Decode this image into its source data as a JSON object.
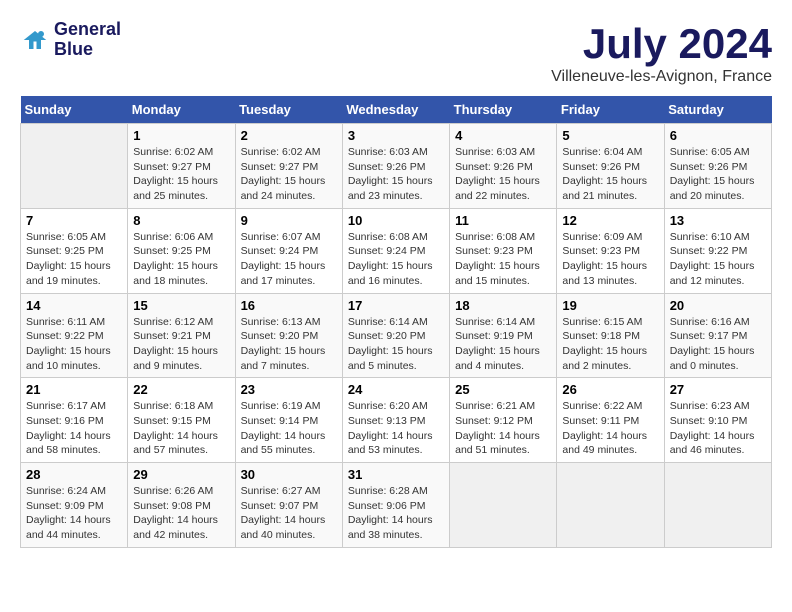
{
  "logo": {
    "line1": "General",
    "line2": "Blue"
  },
  "title": "July 2024",
  "subtitle": "Villeneuve-les-Avignon, France",
  "days_header": [
    "Sunday",
    "Monday",
    "Tuesday",
    "Wednesday",
    "Thursday",
    "Friday",
    "Saturday"
  ],
  "weeks": [
    [
      {
        "num": "",
        "info": ""
      },
      {
        "num": "1",
        "info": "Sunrise: 6:02 AM\nSunset: 9:27 PM\nDaylight: 15 hours\nand 25 minutes."
      },
      {
        "num": "2",
        "info": "Sunrise: 6:02 AM\nSunset: 9:27 PM\nDaylight: 15 hours\nand 24 minutes."
      },
      {
        "num": "3",
        "info": "Sunrise: 6:03 AM\nSunset: 9:26 PM\nDaylight: 15 hours\nand 23 minutes."
      },
      {
        "num": "4",
        "info": "Sunrise: 6:03 AM\nSunset: 9:26 PM\nDaylight: 15 hours\nand 22 minutes."
      },
      {
        "num": "5",
        "info": "Sunrise: 6:04 AM\nSunset: 9:26 PM\nDaylight: 15 hours\nand 21 minutes."
      },
      {
        "num": "6",
        "info": "Sunrise: 6:05 AM\nSunset: 9:26 PM\nDaylight: 15 hours\nand 20 minutes."
      }
    ],
    [
      {
        "num": "7",
        "info": "Sunrise: 6:05 AM\nSunset: 9:25 PM\nDaylight: 15 hours\nand 19 minutes."
      },
      {
        "num": "8",
        "info": "Sunrise: 6:06 AM\nSunset: 9:25 PM\nDaylight: 15 hours\nand 18 minutes."
      },
      {
        "num": "9",
        "info": "Sunrise: 6:07 AM\nSunset: 9:24 PM\nDaylight: 15 hours\nand 17 minutes."
      },
      {
        "num": "10",
        "info": "Sunrise: 6:08 AM\nSunset: 9:24 PM\nDaylight: 15 hours\nand 16 minutes."
      },
      {
        "num": "11",
        "info": "Sunrise: 6:08 AM\nSunset: 9:23 PM\nDaylight: 15 hours\nand 15 minutes."
      },
      {
        "num": "12",
        "info": "Sunrise: 6:09 AM\nSunset: 9:23 PM\nDaylight: 15 hours\nand 13 minutes."
      },
      {
        "num": "13",
        "info": "Sunrise: 6:10 AM\nSunset: 9:22 PM\nDaylight: 15 hours\nand 12 minutes."
      }
    ],
    [
      {
        "num": "14",
        "info": "Sunrise: 6:11 AM\nSunset: 9:22 PM\nDaylight: 15 hours\nand 10 minutes."
      },
      {
        "num": "15",
        "info": "Sunrise: 6:12 AM\nSunset: 9:21 PM\nDaylight: 15 hours\nand 9 minutes."
      },
      {
        "num": "16",
        "info": "Sunrise: 6:13 AM\nSunset: 9:20 PM\nDaylight: 15 hours\nand 7 minutes."
      },
      {
        "num": "17",
        "info": "Sunrise: 6:14 AM\nSunset: 9:20 PM\nDaylight: 15 hours\nand 5 minutes."
      },
      {
        "num": "18",
        "info": "Sunrise: 6:14 AM\nSunset: 9:19 PM\nDaylight: 15 hours\nand 4 minutes."
      },
      {
        "num": "19",
        "info": "Sunrise: 6:15 AM\nSunset: 9:18 PM\nDaylight: 15 hours\nand 2 minutes."
      },
      {
        "num": "20",
        "info": "Sunrise: 6:16 AM\nSunset: 9:17 PM\nDaylight: 15 hours\nand 0 minutes."
      }
    ],
    [
      {
        "num": "21",
        "info": "Sunrise: 6:17 AM\nSunset: 9:16 PM\nDaylight: 14 hours\nand 58 minutes."
      },
      {
        "num": "22",
        "info": "Sunrise: 6:18 AM\nSunset: 9:15 PM\nDaylight: 14 hours\nand 57 minutes."
      },
      {
        "num": "23",
        "info": "Sunrise: 6:19 AM\nSunset: 9:14 PM\nDaylight: 14 hours\nand 55 minutes."
      },
      {
        "num": "24",
        "info": "Sunrise: 6:20 AM\nSunset: 9:13 PM\nDaylight: 14 hours\nand 53 minutes."
      },
      {
        "num": "25",
        "info": "Sunrise: 6:21 AM\nSunset: 9:12 PM\nDaylight: 14 hours\nand 51 minutes."
      },
      {
        "num": "26",
        "info": "Sunrise: 6:22 AM\nSunset: 9:11 PM\nDaylight: 14 hours\nand 49 minutes."
      },
      {
        "num": "27",
        "info": "Sunrise: 6:23 AM\nSunset: 9:10 PM\nDaylight: 14 hours\nand 46 minutes."
      }
    ],
    [
      {
        "num": "28",
        "info": "Sunrise: 6:24 AM\nSunset: 9:09 PM\nDaylight: 14 hours\nand 44 minutes."
      },
      {
        "num": "29",
        "info": "Sunrise: 6:26 AM\nSunset: 9:08 PM\nDaylight: 14 hours\nand 42 minutes."
      },
      {
        "num": "30",
        "info": "Sunrise: 6:27 AM\nSunset: 9:07 PM\nDaylight: 14 hours\nand 40 minutes."
      },
      {
        "num": "31",
        "info": "Sunrise: 6:28 AM\nSunset: 9:06 PM\nDaylight: 14 hours\nand 38 minutes."
      },
      {
        "num": "",
        "info": ""
      },
      {
        "num": "",
        "info": ""
      },
      {
        "num": "",
        "info": ""
      }
    ]
  ]
}
